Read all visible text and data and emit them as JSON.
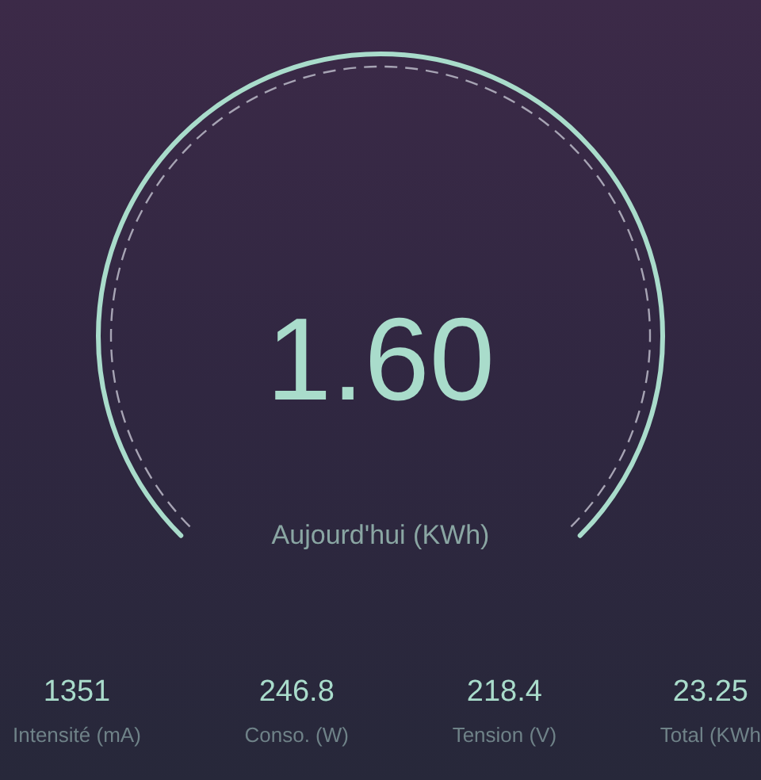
{
  "gauge": {
    "value": "1.60",
    "label": "Aujourd'hui (KWh)"
  },
  "stats": [
    {
      "value": "1351",
      "label": "Intensité (mA)"
    },
    {
      "value": "246.8",
      "label": "Conso. (W)"
    },
    {
      "value": "218.4",
      "label": "Tension (V)"
    },
    {
      "value": "23.25",
      "label": "Total (KWh"
    }
  ]
}
